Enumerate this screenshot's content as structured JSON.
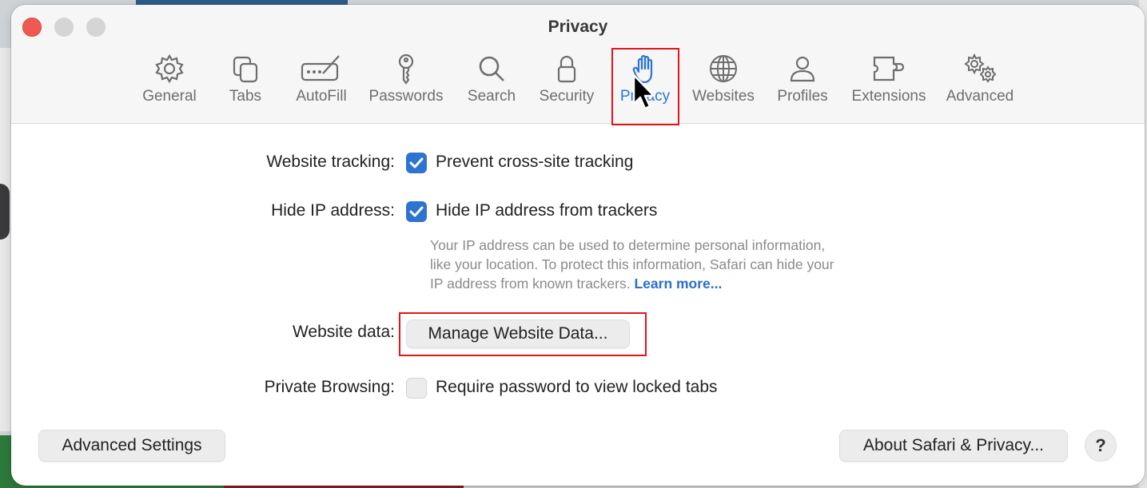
{
  "window": {
    "title": "Privacy"
  },
  "tabs": [
    {
      "label": "General",
      "icon": "gear-icon"
    },
    {
      "label": "Tabs",
      "icon": "tabs-icon"
    },
    {
      "label": "AutoFill",
      "icon": "autofill-icon"
    },
    {
      "label": "Passwords",
      "icon": "key-icon"
    },
    {
      "label": "Search",
      "icon": "search-icon"
    },
    {
      "label": "Security",
      "icon": "lock-icon"
    },
    {
      "label": "Privacy",
      "icon": "hand-icon",
      "active": true
    },
    {
      "label": "Websites",
      "icon": "globe-icon"
    },
    {
      "label": "Profiles",
      "icon": "person-icon"
    },
    {
      "label": "Extensions",
      "icon": "puzzle-icon"
    },
    {
      "label": "Advanced",
      "icon": "gears-icon"
    }
  ],
  "settings": {
    "tracking": {
      "label": "Website tracking:",
      "option": "Prevent cross-site tracking",
      "checked": true
    },
    "hide_ip": {
      "label": "Hide IP address:",
      "option": "Hide IP address from trackers",
      "checked": true,
      "description_lines": [
        "Your IP address can be used to determine personal information,",
        "like your location. To protect this information, Safari can hide your",
        "IP address from known trackers."
      ],
      "learn_more": "Learn more..."
    },
    "website_data": {
      "label": "Website data:",
      "button": "Manage Website Data..."
    },
    "private_browsing": {
      "label": "Private Browsing:",
      "option": "Require password to view locked tabs",
      "checked": false
    }
  },
  "footer": {
    "advanced_settings": "Advanced Settings",
    "about": "About Safari & Privacy...",
    "help": "?"
  },
  "colors": {
    "accent": "#2c73d2",
    "highlight": "#e0151b",
    "close": "#ee5a52"
  }
}
